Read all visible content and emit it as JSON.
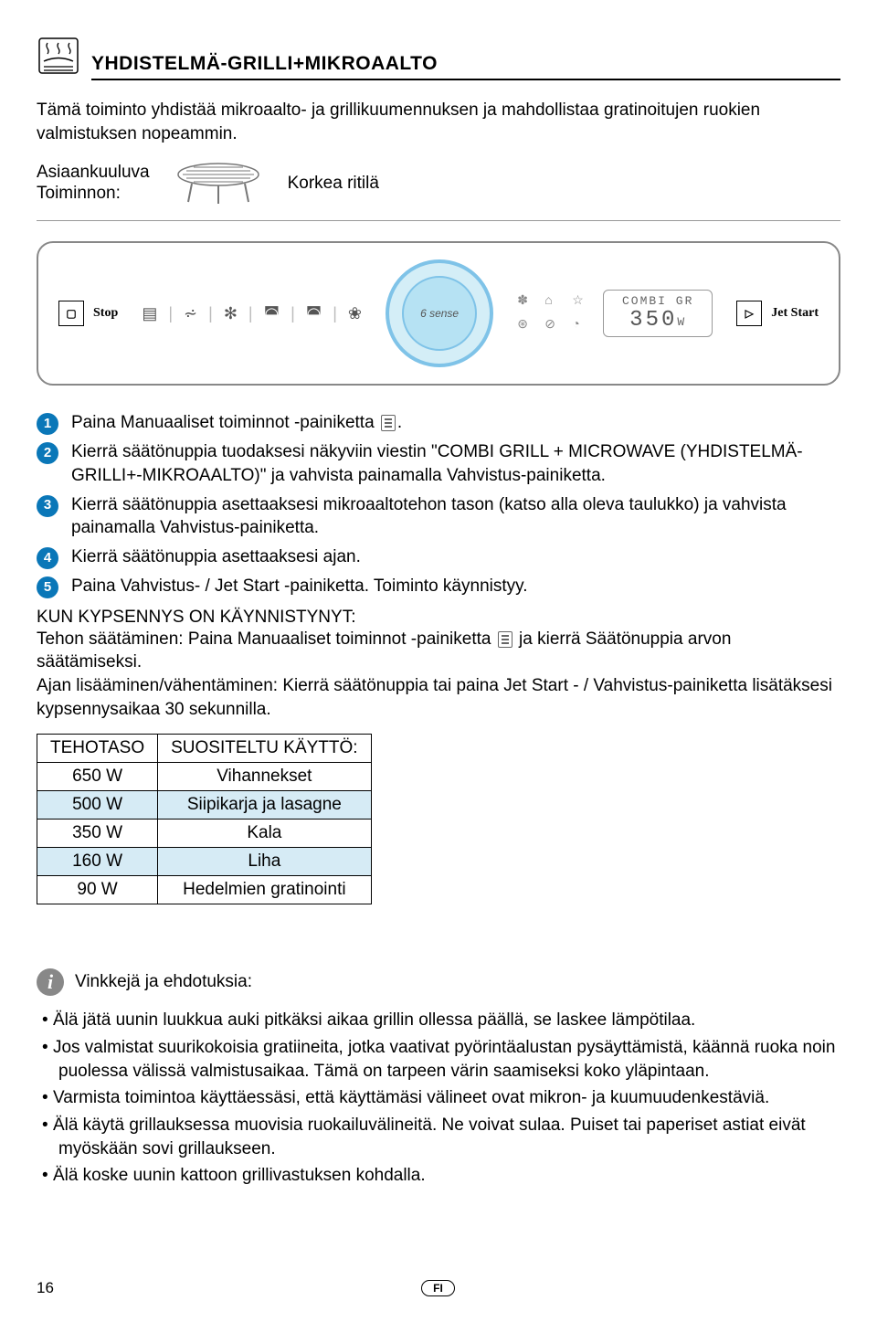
{
  "title": "YHDISTELMÄ-GRILLI+MIKROAALTO",
  "intro": "Tämä toiminto yhdistää mikroaalto- ja grillikuumennuksen ja mahdollistaa gratinoitujen ruokien valmistuksen nopeammin.",
  "accessory_label_1": "Asiaankuuluva",
  "accessory_label_2": "Toiminnon:",
  "accessory_name": "Korkea ritilä",
  "panel": {
    "stop": "Stop",
    "jet": "Jet Start",
    "display_text": "COMBI GR",
    "display_num": "350",
    "display_unit": "W",
    "dial": "6 sense"
  },
  "steps": {
    "s1": "Paina Manuaaliset toiminnot -painiketta ",
    "s1_end": ".",
    "s2": "Kierrä säätönuppia tuodaksesi näkyviin viestin \"COMBI GRILL + MICROWAVE (YHDISTELMÄ-GRILLI+-MIKROAALTO)\" ja vahvista painamalla Vahvistus-painiketta.",
    "s3": "Kierrä säätönuppia asettaaksesi mikroaaltotehon tason (katso alla oleva taulukko) ja vahvista painamalla Vahvistus-painiketta.",
    "s4": "Kierrä säätönuppia  asettaaksesi ajan.",
    "s5": "Paina Vahvistus- / Jet Start -painiketta. Toiminto käynnistyy."
  },
  "after_start_header": "KUN KYPSENNYS ON KÄYNNISTYNYT:",
  "after_start_1a": "Tehon säätäminen: Paina Manuaaliset toiminnot -painiketta ",
  "after_start_1b": " ja kierrä Säätönuppia arvon säätämiseksi.",
  "after_start_2": "Ajan lisääminen/vähentäminen: Kierrä säätönuppia tai paina Jet Start - / Vahvistus-painiketta lisätäksesi kypsennysaikaa 30 sekunnilla.",
  "table": {
    "h1": "TEHOTASO",
    "h2": "SUOSITELTU KÄYTTÖ:",
    "rows": [
      {
        "w": "650 W",
        "use": "Vihannekset"
      },
      {
        "w": "500 W",
        "use": "Siipikarja ja lasagne"
      },
      {
        "w": "350 W",
        "use": "Kala"
      },
      {
        "w": "160 W",
        "use": "Liha"
      },
      {
        "w": "90 W",
        "use": "Hedelmien gratinointi"
      }
    ]
  },
  "tips_title": "Vinkkejä ja ehdotuksia:",
  "tips": [
    "Älä jätä uunin luukkua auki pitkäksi aikaa grillin ollessa päällä, se laskee lämpötilaa.",
    "Jos valmistat suurikokoisia gratiineita, jotka vaativat pyörintäalustan pysäyttämistä, käännä ruoka noin puolessa välissä valmistusaikaa. Tämä on tarpeen värin saamiseksi koko yläpintaan.",
    "Varmista toimintoa käyttäessäsi, että käyttämäsi välineet ovat mikron- ja kuumuudenkestäviä.",
    "Älä käytä grillauksessa muovisia ruokailuvälineitä. Ne voivat sulaa. Puiset tai paperiset astiat eivät myöskään sovi grillaukseen.",
    "Älä koske uunin kattoon grillivastuksen kohdalla."
  ],
  "page_number": "16",
  "lang": "FI"
}
